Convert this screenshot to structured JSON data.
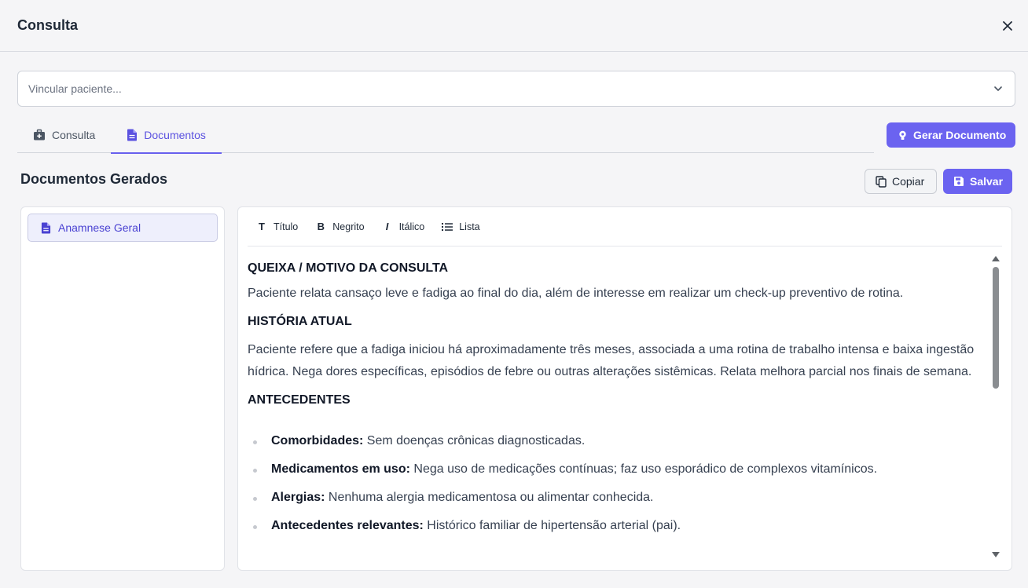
{
  "modal": {
    "title": "Consulta"
  },
  "patient_select": {
    "placeholder": "Vincular paciente..."
  },
  "tabs": [
    {
      "label": "Consulta",
      "icon": "briefcase-medical-icon",
      "active": false
    },
    {
      "label": "Documentos",
      "icon": "file-document-icon",
      "active": true
    }
  ],
  "actions": {
    "generate_label": "Gerar Documento",
    "copy_label": "Copiar",
    "save_label": "Salvar"
  },
  "documents": {
    "section_title": "Documentos Gerados",
    "items": [
      {
        "label": "Anamnese Geral"
      }
    ]
  },
  "toolbar": {
    "title_label": "Título",
    "bold_label": "Negrito",
    "italic_label": "Itálico",
    "list_label": "Lista"
  },
  "document_content": {
    "h1": "QUEIXA / MOTIVO DA CONSULTA",
    "p1": "Paciente relata cansaço leve e fadiga ao final do dia, além de interesse em realizar um check-up preventivo de rotina.",
    "h2": "HISTÓRIA ATUAL",
    "p2": "Paciente refere que a fadiga iniciou há aproximadamente três meses, associada a uma rotina de trabalho intensa e baixa ingestão hídrica. Nega dores específicas, episódios de febre ou outras alterações sistêmicas. Relata melhora parcial nos finais de semana.",
    "h3": "ANTECEDENTES",
    "list": [
      {
        "label": "Comorbidades:",
        "text": " Sem doenças crônicas diagnosticadas."
      },
      {
        "label": "Medicamentos em uso:",
        "text": " Nega uso de medicações contínuas; faz uso esporádico de complexos vitamínicos."
      },
      {
        "label": "Alergias:",
        "text": " Nenhuma alergia medicamentosa ou alimentar conhecida."
      },
      {
        "label": "Antecedentes relevantes:",
        "text": " Histórico familiar de hipertensão arterial (pai)."
      }
    ]
  },
  "colors": {
    "accent": "#6b63f0",
    "background": "#f5f5f7"
  }
}
